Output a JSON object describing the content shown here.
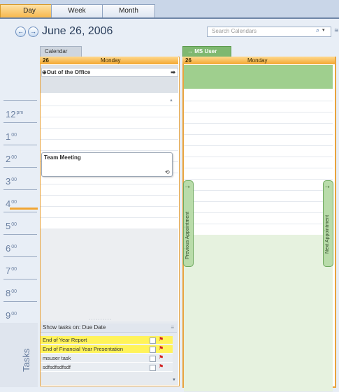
{
  "view_tabs": {
    "day": "Day",
    "week": "Week",
    "month": "Month"
  },
  "header": {
    "date": "June 26, 2006",
    "search_placeholder": "Search Calendars",
    "prev_glyph": "←",
    "next_glyph": "→",
    "search_glyph": "⌕",
    "dropdown_glyph": "▾",
    "edge_glyph": "≋"
  },
  "calendars": {
    "left": {
      "tab": "Calendar",
      "day_number": "26",
      "day_name": "Monday"
    },
    "right": {
      "tab": "MS User",
      "tab_glyph": "→",
      "day_number": "26",
      "day_name": "Monday"
    }
  },
  "all_day": {
    "ooo_label": "Out of the Office",
    "ooo_glyph": "⊕",
    "ooo_arrow": "➡"
  },
  "hours": [
    {
      "h": "12",
      "s": "pm"
    },
    {
      "h": "1",
      "s": "00"
    },
    {
      "h": "2",
      "s": "00"
    },
    {
      "h": "3",
      "s": "00"
    },
    {
      "h": "4",
      "s": "00"
    },
    {
      "h": "5",
      "s": "00"
    },
    {
      "h": "6",
      "s": "00"
    },
    {
      "h": "7",
      "s": "00"
    },
    {
      "h": "8",
      "s": "00"
    },
    {
      "h": "9",
      "s": "00"
    }
  ],
  "appointment": {
    "title": "Team Meeting",
    "recurring_glyph": "⟲"
  },
  "side_tabs": {
    "previous": "Previous Appointment",
    "next": "Next Appointment",
    "arrow": "⇢"
  },
  "tasks": {
    "label": "Tasks",
    "show_label": "Show tasks on: Due Date",
    "items": [
      {
        "name": "End of Year Report"
      },
      {
        "name": "End of Financial Year Presentation"
      },
      {
        "name": "msuser task"
      },
      {
        "name": "sdfsdfsdfsdf"
      }
    ],
    "flag_glyph": "⚑"
  },
  "colors": {
    "accent": "#f1a533",
    "shared_calendar": "#9fcf8e",
    "task_highlight": "#fff35a"
  }
}
